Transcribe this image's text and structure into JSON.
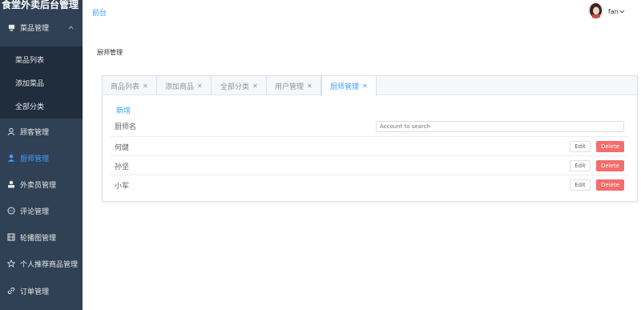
{
  "app": {
    "title": "食堂外卖后台管理"
  },
  "sidebar": {
    "group_label": "菜品管理",
    "sub_items": [
      "菜品列表",
      "添加菜品",
      "全部分类"
    ],
    "items": [
      "顾客管理",
      "厨师管理",
      "外卖员管理",
      "评论管理",
      "轮播图管理",
      "个人推荐商品管理",
      "订单管理"
    ],
    "active_item": "厨师管理",
    "active_color": "#409eff"
  },
  "topbar": {
    "front_link": "前台",
    "username": "fan"
  },
  "breadcrumb": "厨师管理",
  "tabs": [
    {
      "label": "商品列表",
      "active": false
    },
    {
      "label": "添加商品",
      "active": false
    },
    {
      "label": "全部分类",
      "active": false
    },
    {
      "label": "用户管理",
      "active": false
    },
    {
      "label": "厨师管理",
      "active": true
    }
  ],
  "table": {
    "add_label": "新增",
    "column_header": "厨师名",
    "search_placeholder": "Account to search",
    "rows": [
      {
        "name": "何健"
      },
      {
        "name": "孙坚"
      },
      {
        "name": "小军"
      }
    ],
    "edit_label": "Edit",
    "delete_label": "Delete",
    "delete_color": "#f56c6c"
  }
}
